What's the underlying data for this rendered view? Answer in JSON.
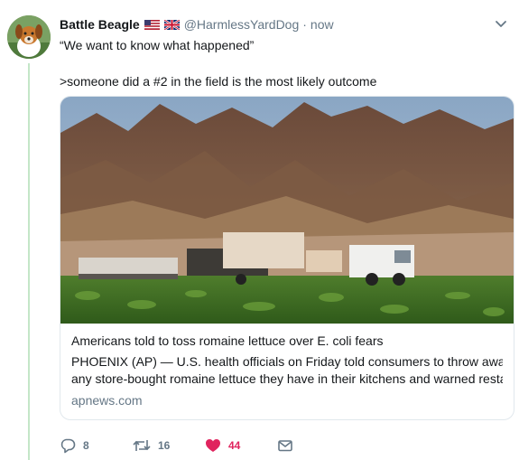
{
  "tweet": {
    "display_name": "Battle Beagle",
    "handle": "@HarmlessYardDog",
    "separator": "·",
    "time": "now",
    "text_line1": "“We want to know what happened”",
    "text_line2": ">someone did a #2 in the field is the most likely outcome"
  },
  "card": {
    "title": "Americans told to toss romaine lettuce over E. coli fears",
    "description_line1": "PHOENIX (AP) — U.S. health officials on Friday told consumers to throw away",
    "description_line2": "any store-bought romaine lettuce they have in their kitchens and warned restau...",
    "domain": "apnews.com"
  },
  "actions": {
    "reply_count": "8",
    "retweet_count": "16",
    "like_count": "44"
  },
  "colors": {
    "like_active": "#e0245e",
    "muted": "#657786",
    "thread_line": "#c4e6c8"
  }
}
